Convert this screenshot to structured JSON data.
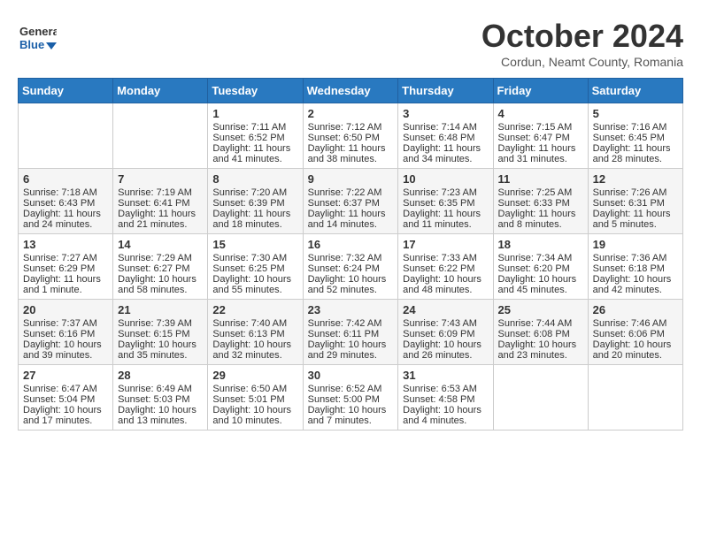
{
  "header": {
    "logo_line1": "General",
    "logo_line2": "Blue",
    "month_title": "October 2024",
    "location": "Cordun, Neamt County, Romania"
  },
  "weekdays": [
    "Sunday",
    "Monday",
    "Tuesday",
    "Wednesday",
    "Thursday",
    "Friday",
    "Saturday"
  ],
  "weeks": [
    [
      {
        "day": "",
        "sunrise": "",
        "sunset": "",
        "daylight": ""
      },
      {
        "day": "",
        "sunrise": "",
        "sunset": "",
        "daylight": ""
      },
      {
        "day": "1",
        "sunrise": "Sunrise: 7:11 AM",
        "sunset": "Sunset: 6:52 PM",
        "daylight": "Daylight: 11 hours and 41 minutes."
      },
      {
        "day": "2",
        "sunrise": "Sunrise: 7:12 AM",
        "sunset": "Sunset: 6:50 PM",
        "daylight": "Daylight: 11 hours and 38 minutes."
      },
      {
        "day": "3",
        "sunrise": "Sunrise: 7:14 AM",
        "sunset": "Sunset: 6:48 PM",
        "daylight": "Daylight: 11 hours and 34 minutes."
      },
      {
        "day": "4",
        "sunrise": "Sunrise: 7:15 AM",
        "sunset": "Sunset: 6:47 PM",
        "daylight": "Daylight: 11 hours and 31 minutes."
      },
      {
        "day": "5",
        "sunrise": "Sunrise: 7:16 AM",
        "sunset": "Sunset: 6:45 PM",
        "daylight": "Daylight: 11 hours and 28 minutes."
      }
    ],
    [
      {
        "day": "6",
        "sunrise": "Sunrise: 7:18 AM",
        "sunset": "Sunset: 6:43 PM",
        "daylight": "Daylight: 11 hours and 24 minutes."
      },
      {
        "day": "7",
        "sunrise": "Sunrise: 7:19 AM",
        "sunset": "Sunset: 6:41 PM",
        "daylight": "Daylight: 11 hours and 21 minutes."
      },
      {
        "day": "8",
        "sunrise": "Sunrise: 7:20 AM",
        "sunset": "Sunset: 6:39 PM",
        "daylight": "Daylight: 11 hours and 18 minutes."
      },
      {
        "day": "9",
        "sunrise": "Sunrise: 7:22 AM",
        "sunset": "Sunset: 6:37 PM",
        "daylight": "Daylight: 11 hours and 14 minutes."
      },
      {
        "day": "10",
        "sunrise": "Sunrise: 7:23 AM",
        "sunset": "Sunset: 6:35 PM",
        "daylight": "Daylight: 11 hours and 11 minutes."
      },
      {
        "day": "11",
        "sunrise": "Sunrise: 7:25 AM",
        "sunset": "Sunset: 6:33 PM",
        "daylight": "Daylight: 11 hours and 8 minutes."
      },
      {
        "day": "12",
        "sunrise": "Sunrise: 7:26 AM",
        "sunset": "Sunset: 6:31 PM",
        "daylight": "Daylight: 11 hours and 5 minutes."
      }
    ],
    [
      {
        "day": "13",
        "sunrise": "Sunrise: 7:27 AM",
        "sunset": "Sunset: 6:29 PM",
        "daylight": "Daylight: 11 hours and 1 minute."
      },
      {
        "day": "14",
        "sunrise": "Sunrise: 7:29 AM",
        "sunset": "Sunset: 6:27 PM",
        "daylight": "Daylight: 10 hours and 58 minutes."
      },
      {
        "day": "15",
        "sunrise": "Sunrise: 7:30 AM",
        "sunset": "Sunset: 6:25 PM",
        "daylight": "Daylight: 10 hours and 55 minutes."
      },
      {
        "day": "16",
        "sunrise": "Sunrise: 7:32 AM",
        "sunset": "Sunset: 6:24 PM",
        "daylight": "Daylight: 10 hours and 52 minutes."
      },
      {
        "day": "17",
        "sunrise": "Sunrise: 7:33 AM",
        "sunset": "Sunset: 6:22 PM",
        "daylight": "Daylight: 10 hours and 48 minutes."
      },
      {
        "day": "18",
        "sunrise": "Sunrise: 7:34 AM",
        "sunset": "Sunset: 6:20 PM",
        "daylight": "Daylight: 10 hours and 45 minutes."
      },
      {
        "day": "19",
        "sunrise": "Sunrise: 7:36 AM",
        "sunset": "Sunset: 6:18 PM",
        "daylight": "Daylight: 10 hours and 42 minutes."
      }
    ],
    [
      {
        "day": "20",
        "sunrise": "Sunrise: 7:37 AM",
        "sunset": "Sunset: 6:16 PM",
        "daylight": "Daylight: 10 hours and 39 minutes."
      },
      {
        "day": "21",
        "sunrise": "Sunrise: 7:39 AM",
        "sunset": "Sunset: 6:15 PM",
        "daylight": "Daylight: 10 hours and 35 minutes."
      },
      {
        "day": "22",
        "sunrise": "Sunrise: 7:40 AM",
        "sunset": "Sunset: 6:13 PM",
        "daylight": "Daylight: 10 hours and 32 minutes."
      },
      {
        "day": "23",
        "sunrise": "Sunrise: 7:42 AM",
        "sunset": "Sunset: 6:11 PM",
        "daylight": "Daylight: 10 hours and 29 minutes."
      },
      {
        "day": "24",
        "sunrise": "Sunrise: 7:43 AM",
        "sunset": "Sunset: 6:09 PM",
        "daylight": "Daylight: 10 hours and 26 minutes."
      },
      {
        "day": "25",
        "sunrise": "Sunrise: 7:44 AM",
        "sunset": "Sunset: 6:08 PM",
        "daylight": "Daylight: 10 hours and 23 minutes."
      },
      {
        "day": "26",
        "sunrise": "Sunrise: 7:46 AM",
        "sunset": "Sunset: 6:06 PM",
        "daylight": "Daylight: 10 hours and 20 minutes."
      }
    ],
    [
      {
        "day": "27",
        "sunrise": "Sunrise: 6:47 AM",
        "sunset": "Sunset: 5:04 PM",
        "daylight": "Daylight: 10 hours and 17 minutes."
      },
      {
        "day": "28",
        "sunrise": "Sunrise: 6:49 AM",
        "sunset": "Sunset: 5:03 PM",
        "daylight": "Daylight: 10 hours and 13 minutes."
      },
      {
        "day": "29",
        "sunrise": "Sunrise: 6:50 AM",
        "sunset": "Sunset: 5:01 PM",
        "daylight": "Daylight: 10 hours and 10 minutes."
      },
      {
        "day": "30",
        "sunrise": "Sunrise: 6:52 AM",
        "sunset": "Sunset: 5:00 PM",
        "daylight": "Daylight: 10 hours and 7 minutes."
      },
      {
        "day": "31",
        "sunrise": "Sunrise: 6:53 AM",
        "sunset": "Sunset: 4:58 PM",
        "daylight": "Daylight: 10 hours and 4 minutes."
      },
      {
        "day": "",
        "sunrise": "",
        "sunset": "",
        "daylight": ""
      },
      {
        "day": "",
        "sunrise": "",
        "sunset": "",
        "daylight": ""
      }
    ]
  ]
}
